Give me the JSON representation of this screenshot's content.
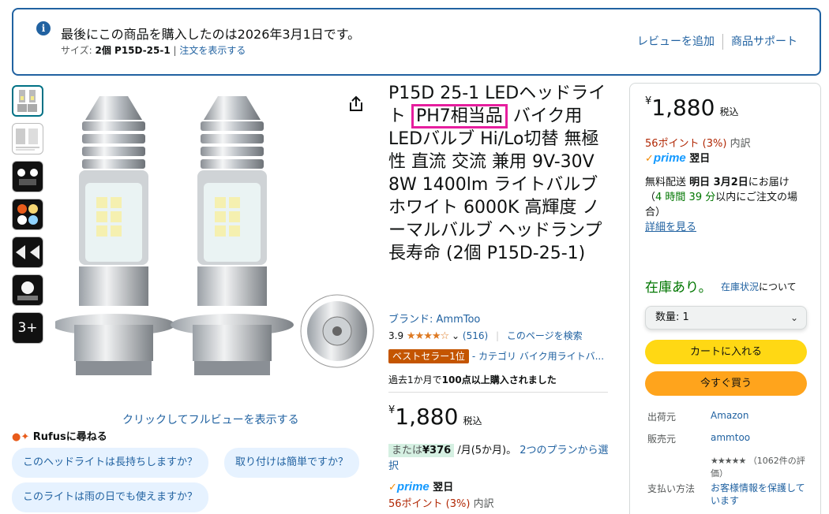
{
  "banner": {
    "message": "最後にこの商品を購入したのは2026年3月1日です。",
    "size_label": "サイズ: ",
    "size_value": "2個 P15D-25-1",
    "sep": " | ",
    "view_order": "注文を表示する",
    "add_review": "レビューを追加",
    "product_support": "商品サポート"
  },
  "gallery": {
    "click_hint": "クリックしてフルビューを表示する",
    "more_label": "3+"
  },
  "rufus": {
    "title": "Rufusに尋ねる",
    "questions": [
      "このヘッドライトは長持ちしますか？",
      "取り付けは簡単ですか？",
      "このライトは雨の日でも使えますか？"
    ]
  },
  "product": {
    "title_before": "P15D 25-1 LEDヘッドライト ",
    "title_highlight": "PH7相当品",
    "title_after": " バイク用 LEDバルブ Hi/Lo切替 無極性 直流 交流 兼用 9V-30V 8W 1400lm ライトバルブ ホワイト 6000K 高輝度 ノーマルバルブ ヘッドランプ 長寿命 (2個 P15D-25-1)",
    "brand": "ブランド: AmmToo",
    "rating": "3.9",
    "stars": "★★★★☆",
    "review_count": "(516)",
    "search_page": "このページを検索",
    "bestseller_badge": "ベストセラー1位",
    "bestseller_category": "- カテゴリ バイク用ライトバ...",
    "bought_bold": "100点以上購入されました",
    "bought_prefix": "過去1か月で",
    "price_symbol": "¥",
    "price": "1,880",
    "tax": "税込",
    "installment_prefix": "または",
    "installment_amount": "¥376",
    "installment_suffix": " /月(5か月)。",
    "installment_link": "2つのプランから選択",
    "prime": "prime",
    "prime_delivery": "翌日",
    "points": "56ポイント (3%)",
    "points_detail": "内訳"
  },
  "buybox": {
    "price_symbol": "¥",
    "price": "1,880",
    "tax": "税込",
    "points": "56ポイント (3%)",
    "points_detail": "内訳",
    "prime": "prime",
    "prime_delivery": "翌日",
    "delivery_prefix": "無料配送 ",
    "delivery_date": "明日 3月2日",
    "delivery_suffix": "にお届け",
    "countdown_open": "（",
    "countdown_hours": "4 時間 39 分",
    "countdown_close": "以内にご注文の場合）",
    "details_link": "詳細を見る",
    "in_stock": "在庫あり。",
    "stock_status": "在庫状況",
    "stock_about": "について",
    "quantity_label": "数量: 1",
    "add_to_cart": "カートに入れる",
    "buy_now": "今すぐ買う",
    "ships_from_label": "出荷元",
    "ships_from": "Amazon",
    "seller_label": "販売元",
    "seller": "ammtoo",
    "seller_stars": "★★★★★",
    "seller_reviews": "（1062件の評価）",
    "payment_label": "支払い方法",
    "secure": "お客様情報を保護しています"
  }
}
